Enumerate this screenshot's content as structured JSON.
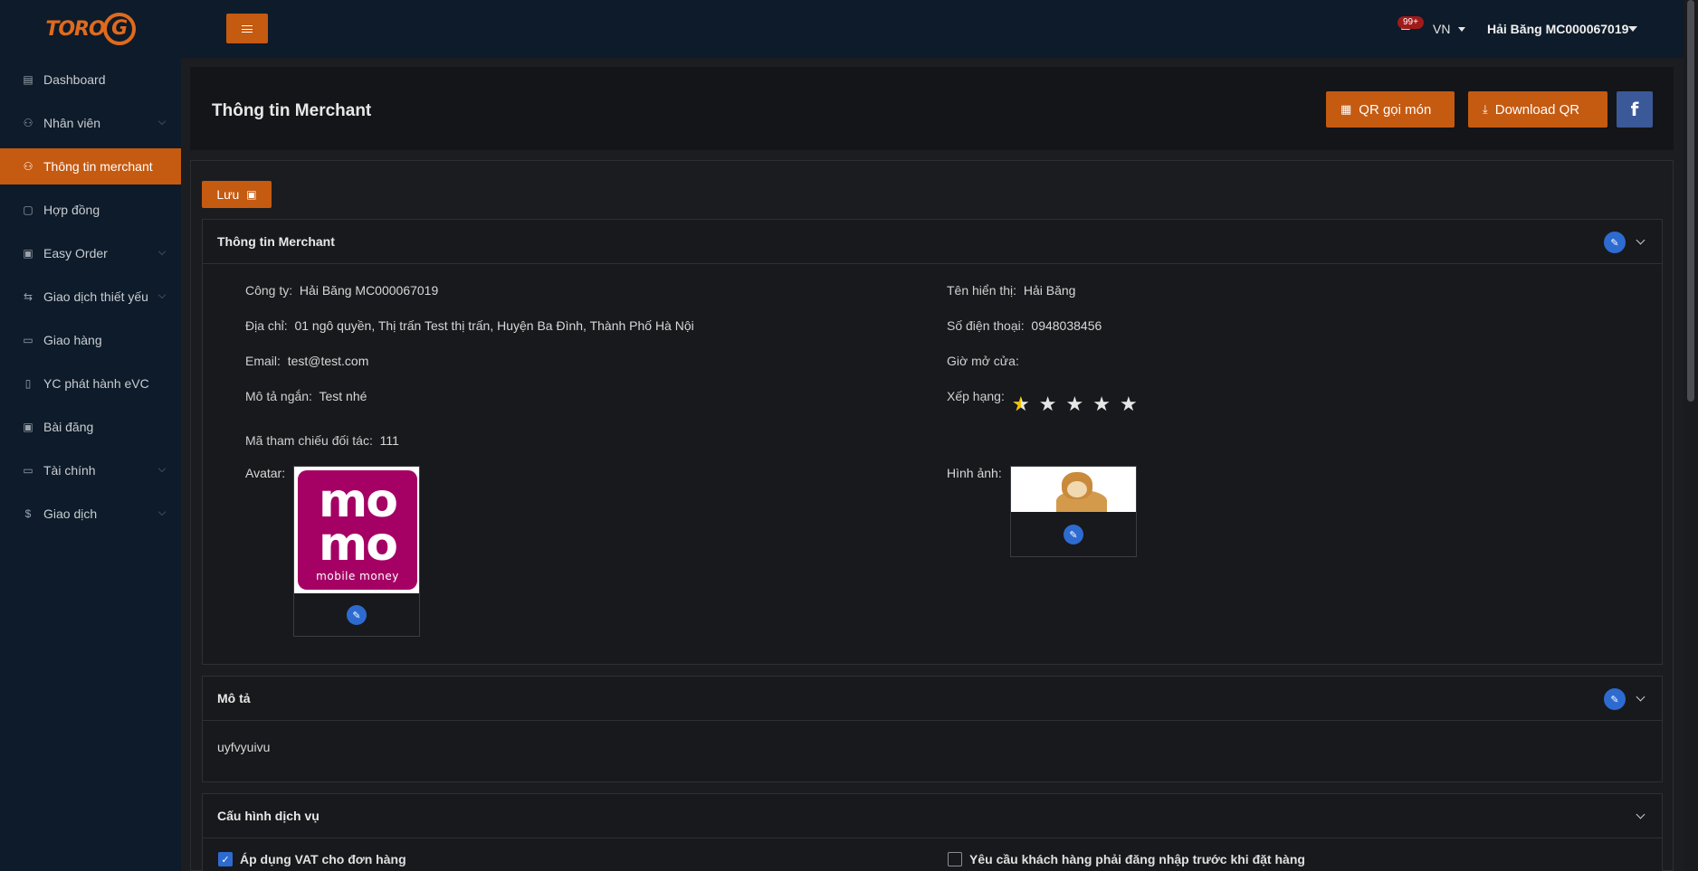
{
  "brand": {
    "logo_text": "TORO",
    "logo_letter": "G"
  },
  "sidebar": {
    "items": [
      {
        "label": "Dashboard",
        "icon": "chart-icon",
        "active": false,
        "has_caret": false
      },
      {
        "label": "Nhân viên",
        "icon": "users-icon",
        "active": false,
        "has_caret": true
      },
      {
        "label": "Thông tin merchant",
        "icon": "users-icon",
        "active": true,
        "has_caret": false
      },
      {
        "label": "Hợp đồng",
        "icon": "contract-icon",
        "active": false,
        "has_caret": false
      },
      {
        "label": "Easy Order",
        "icon": "order-icon",
        "active": false,
        "has_caret": true
      },
      {
        "label": "Giao dịch thiết yếu",
        "icon": "transfer-icon",
        "active": false,
        "has_caret": true
      },
      {
        "label": "Giao hàng",
        "icon": "delivery-icon",
        "active": false,
        "has_caret": false
      },
      {
        "label": "YC phát hành eVC",
        "icon": "document-icon",
        "active": false,
        "has_caret": false
      },
      {
        "label": "Bài đăng",
        "icon": "post-icon",
        "active": false,
        "has_caret": false
      },
      {
        "label": "Tài chính",
        "icon": "finance-icon",
        "active": false,
        "has_caret": true
      },
      {
        "label": "Giao dịch",
        "icon": "dollar-icon",
        "active": false,
        "has_caret": true
      }
    ]
  },
  "topbar": {
    "notification_count": "99+",
    "language": "VN",
    "user_name": "Hải Băng MC000067019"
  },
  "header": {
    "title": "Thông tin Merchant",
    "qr_order_label": "QR gọi món",
    "download_qr_label": "Download QR",
    "facebook_label": "f"
  },
  "content": {
    "save_label": "Lưu",
    "merchant_card": {
      "title": "Thông tin Merchant",
      "company_label": "Công ty:",
      "company_value": "Hải Băng MC000067019",
      "display_name_label": "Tên hiển thị:",
      "display_name_value": "Hải Băng",
      "address_label": "Địa chỉ:",
      "address_value": "01 ngô quyền, Thị trấn Test thị trấn, Huyện Ba Đình, Thành Phố Hà Nội",
      "phone_label": "Số điện thoại:",
      "phone_value": "0948038456",
      "email_label": "Email:",
      "email_value": "test@test.com",
      "opening_hours_label": "Giờ mở cửa:",
      "opening_hours_value": "",
      "short_desc_label": "Mô tả ngắn:",
      "short_desc_value": "Test nhé",
      "rating_label": "Xếp hạng:",
      "rating_value": 0.5,
      "rating_max": 5,
      "partner_ref_label": "Mã tham chiếu đối tác:",
      "partner_ref_value": "111",
      "avatar_label": "Avatar:",
      "avatar_logo": {
        "line1": "mo",
        "line2": "mo",
        "tagline": "mobile money",
        "color": "#a50064"
      },
      "image_label": "Hình ảnh:"
    },
    "description_card": {
      "title": "Mô tả",
      "text": "uyfvyuivu"
    },
    "service_card": {
      "title": "Cấu hình dịch vụ",
      "vat_label": "Áp dụng VAT cho đơn hàng",
      "vat_checked": true,
      "login_required_label": "Yêu cầu khách hàng phải đăng nhập trước khi đặt hàng",
      "login_required_checked": false
    }
  },
  "colors": {
    "accent": "#c55a11",
    "sidebar_bg": "#0d1b2a",
    "edit_blue": "#2e6bd0",
    "facebook_blue": "#3b5998",
    "star_gold": "#f2c200"
  }
}
